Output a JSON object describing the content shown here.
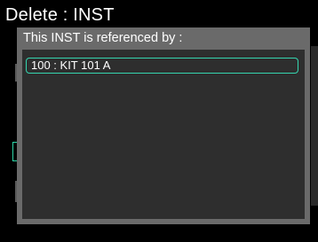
{
  "page": {
    "title": "Delete : INST"
  },
  "dialog": {
    "title": "This INST is referenced by :",
    "references": [
      {
        "label": "100 : KIT 101 A"
      }
    ]
  },
  "colors": {
    "background": "#000000",
    "dialog_frame": "#6a6a6a",
    "dialog_body": "#2e2e2e",
    "selection_accent": "#35d6b0",
    "text": "#ffffff"
  }
}
